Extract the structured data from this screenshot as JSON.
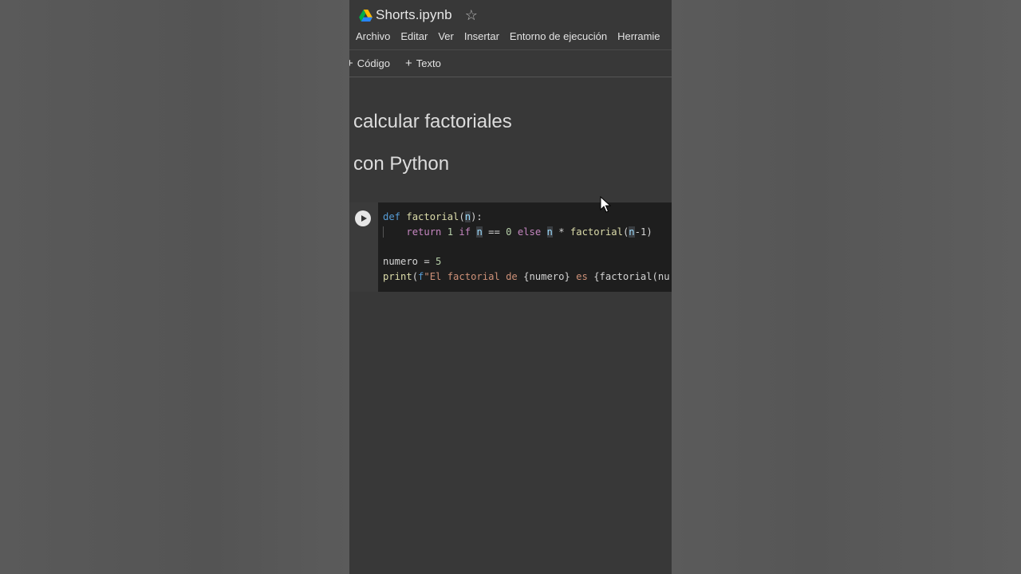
{
  "notebook": {
    "title": "Shorts.ipynb",
    "icon": "google-drive-icon",
    "star_icon": "star-outline-icon"
  },
  "menu": {
    "items": [
      "Archivo",
      "Editar",
      "Ver",
      "Insertar",
      "Entorno de ejecución",
      "Herramie"
    ]
  },
  "toolbar": {
    "code_label": "Código",
    "text_label": "Texto",
    "plus_icon": "plus-icon"
  },
  "markdown": {
    "line1": "calcular factoriales",
    "line2": "con Python"
  },
  "code_cell": {
    "run_icon": "play-icon",
    "lines": {
      "l1": {
        "kw": "def",
        "fn": "factorial",
        "open": "(",
        "param": "n",
        "close": "):"
      },
      "l2": {
        "indent": "    ",
        "ret": "return",
        "one": "1",
        "if": "if",
        "n1": "n",
        "eq": " == ",
        "zero": "0",
        "else": "else",
        "n2": "n",
        "mul": " * ",
        "fn": "factorial",
        "open": "(",
        "n3": "n",
        "rest": "-1)"
      },
      "l4": {
        "var": "numero",
        "eq": " = ",
        "val": "5"
      },
      "l5": {
        "fn": "print",
        "open": "(",
        "prefix": "f",
        "str1": "\"El factorial de ",
        "interp1": "{numero}",
        "str2": " es ",
        "interp2": "{factorial(nu"
      }
    }
  },
  "colors": {
    "notebook_bg": "#383838",
    "code_bg": "#1e1e1e",
    "keyword": "#569cd6",
    "control": "#c586c0",
    "function": "#dcdcaa",
    "number": "#b5cea8",
    "string": "#ce9178"
  }
}
